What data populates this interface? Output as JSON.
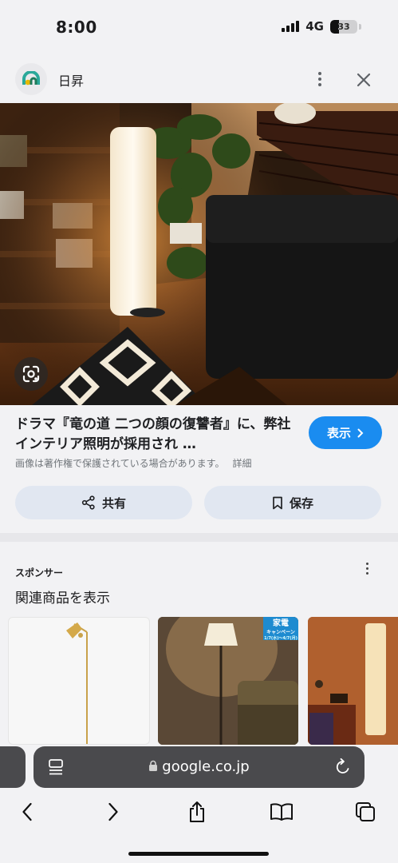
{
  "status_bar": {
    "time": "8:00",
    "network": "4G",
    "battery": "33",
    "battery_level": 0.33,
    "signal_bars": 4
  },
  "header": {
    "site_name": "日昇",
    "logo_icon": "site-logo-icon",
    "more_icon": "more-vert-icon",
    "close_icon": "close-icon"
  },
  "image": {
    "lens_icon": "google-lens-icon"
  },
  "result": {
    "title": "ドラマ『竜の道 二つの顔の復讐者』に、弊社インテリア照明が採用され …",
    "show_button": "表示",
    "copyright_notice": "画像は著作権で保護されている場合があります。",
    "detail_link": "詳細",
    "share_button": "共有",
    "save_button": "保存"
  },
  "sponsored": {
    "label": "スポンサー",
    "heading": "関連商品を表示",
    "badge_main": "家電",
    "badge_sub": "キャンペーン",
    "badge_date": "1/7(水)〜4/7(月)"
  },
  "browser": {
    "url": "google.co.jp",
    "icons": [
      "reader-icon",
      "lock-icon",
      "reload-icon",
      "back-icon",
      "forward-icon",
      "share-icon",
      "bookmarks-icon",
      "tabs-icon"
    ]
  },
  "colors": {
    "accent": "#1a8cf0",
    "action_bg": "#e1e7f1",
    "url_bar_bg": "#4a4a4d",
    "page_bg": "#f2f2f4"
  }
}
